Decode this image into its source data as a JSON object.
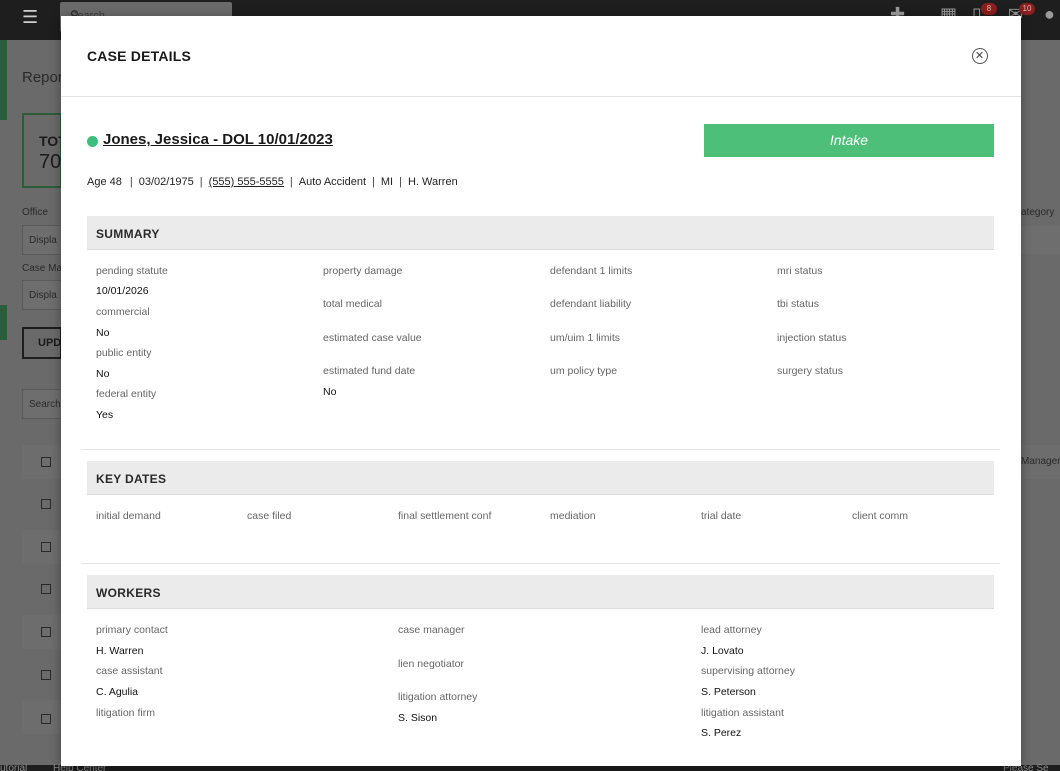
{
  "background": {
    "search_placeholder": "Search",
    "page_title": "Repor",
    "total_label": "TOT",
    "total_value": "70",
    "office_label": "Office",
    "office_value": "Displa",
    "case_manager_label": "Case Ma",
    "case_manager_value": "Displa",
    "update_button": "UPD",
    "search_small": "Search",
    "category_label": "ategory",
    "manager_label": "Manager",
    "footer_left": "utorial",
    "footer_help": "Help Center",
    "footer_right": "Please Se",
    "badge_messages": "8",
    "badge_mail": "10"
  },
  "modal": {
    "title": "CASE DETAILS",
    "case_name": "Jones, Jessica - DOL 10/01/2023",
    "stage": "Intake",
    "meta": {
      "age": "Age 48",
      "dob": "03/02/1975",
      "phone": "(555) 555-5555",
      "case_type": "Auto Accident",
      "state": "MI",
      "attorney": "H. Warren"
    },
    "summary": {
      "header": "SUMMARY",
      "pending_statute_label": "pending statute",
      "pending_statute_value": "10/01/2026",
      "commercial_label": "commercial",
      "commercial_value": "No",
      "public_entity_label": "public entity",
      "public_entity_value": "No",
      "federal_entity_label": "federal entity",
      "federal_entity_value": "Yes",
      "property_damage_label": "property damage",
      "total_medical_label": "total medical",
      "estimated_case_value_label": "estimated case value",
      "estimated_fund_date_label": "estimated fund date",
      "estimated_fund_date_value": "No",
      "defendant_1_limits_label": "defendant 1 limits",
      "defendant_liability_label": "defendant liability",
      "um_uim_1_limits_label": "um/uim 1 limits",
      "um_policy_type_label": "um policy type",
      "mri_status_label": "mri status",
      "tbi_status_label": "tbi status",
      "injection_status_label": "injection status",
      "surgery_status_label": "surgery status"
    },
    "key_dates": {
      "header": "KEY DATES",
      "initial_demand": "initial demand",
      "case_filed": "case filed",
      "final_settlement_conf": "final settlement conf",
      "mediation": "mediation",
      "trial_date": "trial date",
      "client_comm": "client comm"
    },
    "workers": {
      "header": "WORKERS",
      "primary_contact_label": "primary contact",
      "primary_contact_value": "H. Warren",
      "case_assistant_label": "case assistant",
      "case_assistant_value": "C. Agulia",
      "litigation_firm_label": "litigation firm",
      "case_manager_label": "case manager",
      "lien_negotiator_label": "lien negotiator",
      "litigation_attorney_label": "litigation attorney",
      "litigation_attorney_value": "S. Sison",
      "lead_attorney_label": "lead attorney",
      "lead_attorney_value": "J. Lovato",
      "supervising_attorney_label": "supervising attorney",
      "supervising_attorney_value": "S. Peterson",
      "litigation_assistant_label": "litigation assistant",
      "litigation_assistant_value": "S. Perez"
    }
  }
}
